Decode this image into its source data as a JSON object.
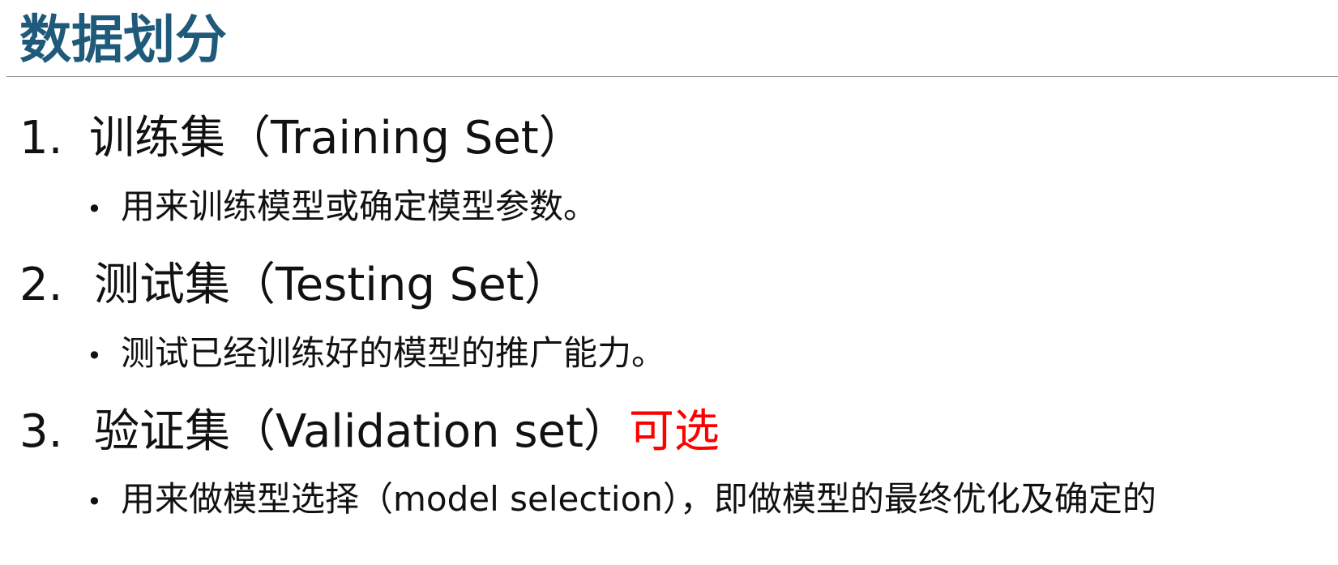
{
  "slide": {
    "title": "数据划分",
    "items": [
      {
        "number": "1.",
        "heading": "训练集（Training Set）",
        "accent": "",
        "bullet": "用来训练模型或确定模型参数。"
      },
      {
        "number": "2.",
        "heading": "测试集（Testing Set）",
        "accent": "",
        "bullet": "测试已经训练好的模型的推广能力。"
      },
      {
        "number": "3.",
        "heading": "验证集（Validation set）",
        "accent": "可选",
        "bullet": "用来做模型选择（model selection），即做模型的最终优化及确定的"
      }
    ],
    "bullet_symbol": "•",
    "colors": {
      "title": "#1f5a7a",
      "accent": "#ff0000",
      "text": "#111111"
    }
  }
}
